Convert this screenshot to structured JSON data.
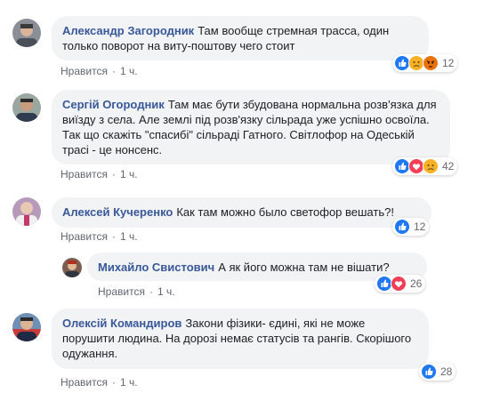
{
  "comments": [
    {
      "author": "Александр Загородник",
      "text": "Там вообще стремная трасса, один только поворот на виту-поштову чего стоит",
      "like_label": "Нравится",
      "time": "1 ч.",
      "reactions": [
        "like",
        "sad",
        "angry"
      ],
      "reaction_count": "12"
    },
    {
      "author": "Сергій Огородник",
      "text": "Там має бути збудована нормальна розв'язка для виїзду з села. Але землі під розв'язку сільрада уже успішно освоїла. Так що скажіть \"спасибі\" сільраді Гатного. Світлофор на Одеській трасі - це нонсенс.",
      "like_label": "Нравится",
      "time": "1 ч.",
      "reactions": [
        "like",
        "love",
        "sad"
      ],
      "reaction_count": "42"
    },
    {
      "author": "Алексей Кучеренко",
      "text": "Как там можно было светофор вешать?!",
      "like_label": "Нравится",
      "time": "1 ч.",
      "reactions": [
        "like"
      ],
      "reaction_count": "12"
    },
    {
      "author": "Михайло Свистович",
      "text": "А як його можна там не вішати?",
      "like_label": "Нравится",
      "time": "1 ч.",
      "reactions": [
        "like",
        "love"
      ],
      "reaction_count": "26"
    },
    {
      "author": "Олексій Командиров",
      "text": "Закони фізики- єдині, які не може порушити людина. На дорозі немає статусів та рангів. Скорішого одужання.",
      "like_label": "Нравится",
      "time": "1 ч.",
      "reactions": [
        "like"
      ],
      "reaction_count": "28"
    }
  ],
  "separator": "·",
  "colors": {
    "bubble": "#f2f3f5",
    "author": "#385898",
    "meta": "#606770",
    "like": "#2078f4",
    "love": "#f33e58",
    "sad": "#f7b125",
    "angry": "#e9710f"
  }
}
